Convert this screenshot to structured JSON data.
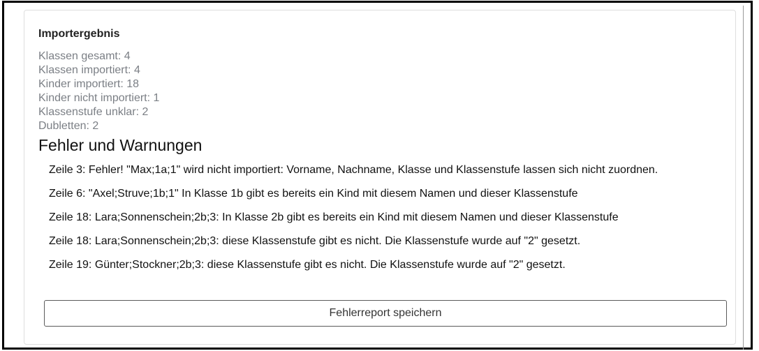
{
  "result": {
    "title": "Importergebnis",
    "stats": [
      "Klassen gesamt: 4",
      "Klassen importiert: 4",
      "Kinder importiert: 18",
      "Kinder nicht importiert: 1",
      "Klassenstufe unklar: 2",
      "Dubletten: 2"
    ]
  },
  "errors": {
    "title": "Fehler und Warnungen",
    "messages": [
      "Zeile 3: Fehler! \"Max;1a;1\" wird nicht importiert: Vorname, Nachname, Klasse und Klassenstufe lassen sich nicht zuordnen.",
      "Zeile 6: \"Axel;Struve;1b;1\" In Klasse 1b gibt es bereits ein Kind mit diesem Namen und dieser Klassenstufe",
      "Zeile 18: Lara;Sonnenschein;2b;3: In Klasse 2b gibt es bereits ein Kind mit diesem Namen und dieser Klassenstufe",
      "Zeile 18: Lara;Sonnenschein;2b;3: diese Klassenstufe gibt es nicht. Die Klassenstufe wurde auf \"2\" gesetzt.",
      "Zeile 19: Günter;Stockner;2b;3: diese Klassenstufe gibt es nicht. Die Klassenstufe wurde auf \"2\" gesetzt."
    ]
  },
  "actions": {
    "save_report_label": "Fehlerreport speichern"
  }
}
